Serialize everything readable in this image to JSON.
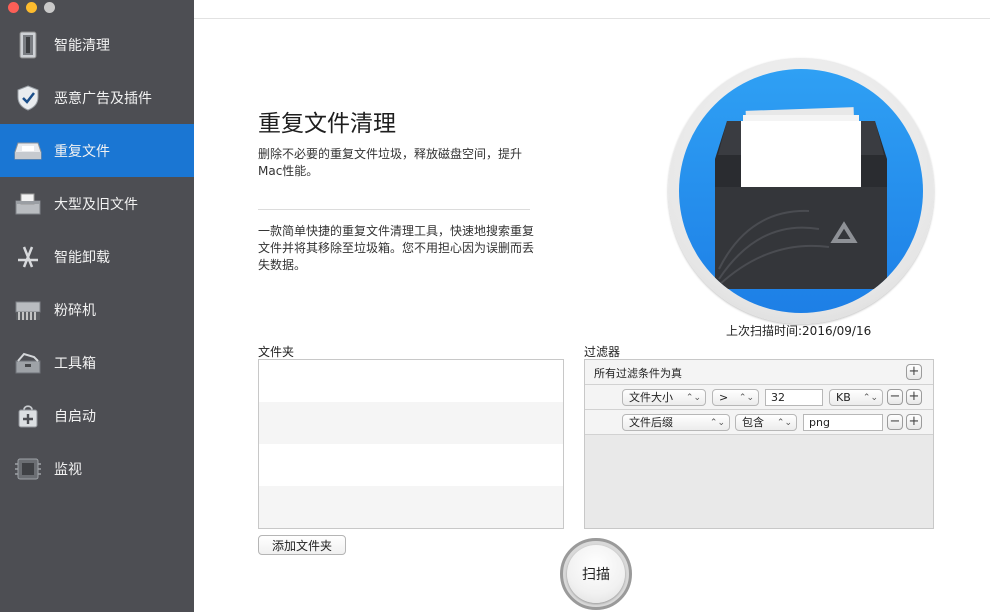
{
  "sidebar": {
    "items": [
      {
        "label": "智能清理",
        "icon": "mac-pro-icon"
      },
      {
        "label": "恶意广告及插件",
        "icon": "shield-icon"
      },
      {
        "label": "重复文件",
        "icon": "tray-icon",
        "active": true
      },
      {
        "label": "大型及旧文件",
        "icon": "file-box-icon"
      },
      {
        "label": "智能卸载",
        "icon": "app-store-icon"
      },
      {
        "label": "粉碎机",
        "icon": "shredder-icon"
      },
      {
        "label": "工具箱",
        "icon": "toolbox-icon"
      },
      {
        "label": "自启动",
        "icon": "startup-bag-icon"
      },
      {
        "label": "监视",
        "icon": "ram-chip-icon"
      }
    ]
  },
  "main": {
    "title": "重复文件清理",
    "subtitle": "删除不必要的重复文件垃圾，释放磁盘空间，提升Mac性能。",
    "description": "一款简单快捷的重复文件清理工具，快速地搜索重复文件并将其移除至垃圾箱。您不用担心因为误删而丢失数据。",
    "last_scan": "上次扫描时间:2016/09/16",
    "folder_label": "文件夹",
    "add_folder_label": "添加文件夹",
    "filter_label": "过滤器",
    "filter_all_label": "所有过滤条件为真",
    "filters": [
      {
        "field": "文件大小",
        "operator": ">",
        "value": "32",
        "unit": "KB"
      },
      {
        "field": "文件后缀",
        "operator": "包含",
        "value": "png"
      }
    ],
    "scan_label": "扫描"
  },
  "colors": {
    "sidebar_bg": "#4d4e53",
    "active_item": "#1a76d3",
    "hero_blue": "#1d7fe6"
  }
}
